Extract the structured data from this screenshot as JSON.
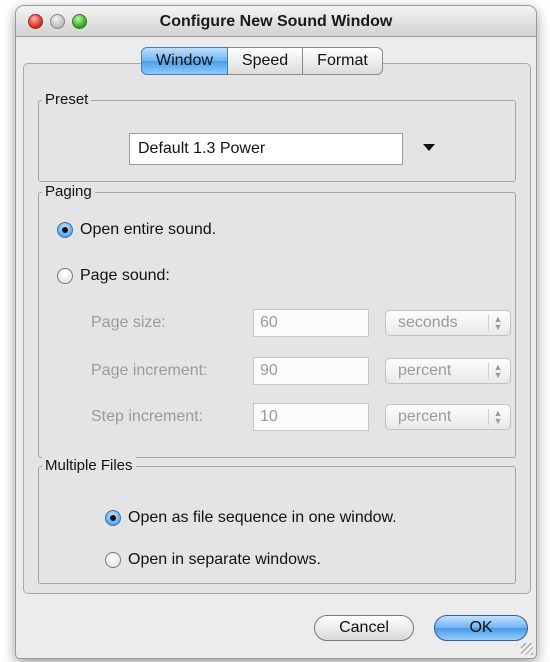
{
  "window": {
    "title": "Configure New Sound Window"
  },
  "tabs": [
    {
      "label": "Window",
      "active": true
    },
    {
      "label": "Speed",
      "active": false
    },
    {
      "label": "Format",
      "active": false
    }
  ],
  "preset": {
    "label": "Preset",
    "selected": "Default 1.3 Power"
  },
  "paging": {
    "label": "Paging",
    "options": [
      {
        "label": "Open entire sound.",
        "selected": true
      },
      {
        "label": "Page sound:",
        "selected": false
      }
    ],
    "fields": [
      {
        "label": "Page size:",
        "value": "60",
        "unit": "seconds"
      },
      {
        "label": "Page increment:",
        "value": "90",
        "unit": "percent"
      },
      {
        "label": "Step increment:",
        "value": "10",
        "unit": "percent"
      }
    ]
  },
  "multiple_files": {
    "label": "Multiple Files",
    "options": [
      {
        "label": "Open as file sequence in one window.",
        "selected": true
      },
      {
        "label": "Open in separate windows.",
        "selected": false
      }
    ]
  },
  "buttons": {
    "cancel": "Cancel",
    "ok": "OK"
  },
  "colors": {
    "accent": "#5aa7ee",
    "window_bg": "#ececec"
  }
}
